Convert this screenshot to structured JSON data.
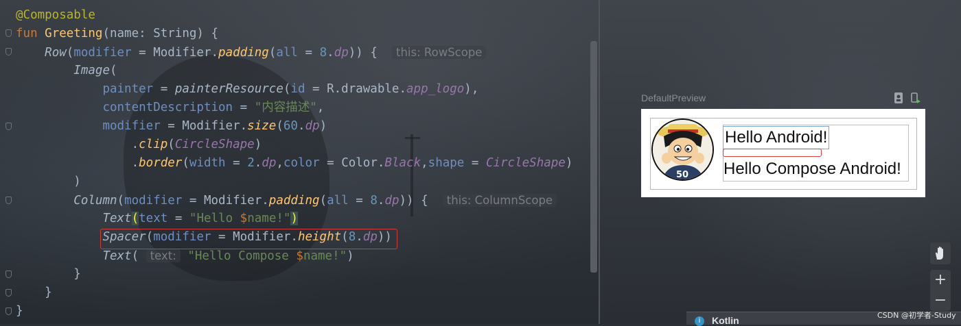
{
  "editor": {
    "code_lines": [
      "@Composable",
      "fun Greeting(name: String) {",
      "Row(modifier = Modifier.padding(all = 8.dp)) {",
      "Image(",
      "painter = painterResource(id = R.drawable.app_logo),",
      "contentDescription = \"内容描述\",",
      "modifier = Modifier.size(60.dp)",
      ".clip(CircleShape)",
      ".border(width = 2.dp,color = Color.Black,shape = CircleShape)",
      ")",
      "Column(modifier = Modifier.padding(all = 8.dp)) {",
      "Text(text = \"Hello $name!\")",
      "Spacer(modifier = Modifier.height(8.dp))",
      "Text( text: \"Hello Compose $name!\")",
      "}",
      "}",
      "}"
    ],
    "hints": {
      "row_scope": "this: RowScope",
      "column_scope": "this: ColumnScope",
      "text_param": "text:"
    },
    "highlighted_line": "Spacer(modifier = Modifier.height(8.dp))"
  },
  "preview": {
    "title": "DefaultPreview",
    "text1": "Hello Android!",
    "text2": "Hello Compose Android!",
    "avatar_number": "50",
    "icons": [
      "preview-interactive-icon",
      "deploy-preview-icon"
    ]
  },
  "tools": {
    "pan": "pan-hand-icon",
    "zoom_in": "+",
    "zoom_out": "−"
  },
  "notification": {
    "label": "Kotlin",
    "icon": "info-icon"
  },
  "watermark": "CSDN @初学者-Study",
  "colors": {
    "keyword": "#cc7832",
    "function": "#ffc66d",
    "annotation": "#bbb529",
    "string": "#6a8759",
    "number": "#6897bb",
    "parameter": "#6f8ec0",
    "highlight_box": "#d23b3b"
  }
}
